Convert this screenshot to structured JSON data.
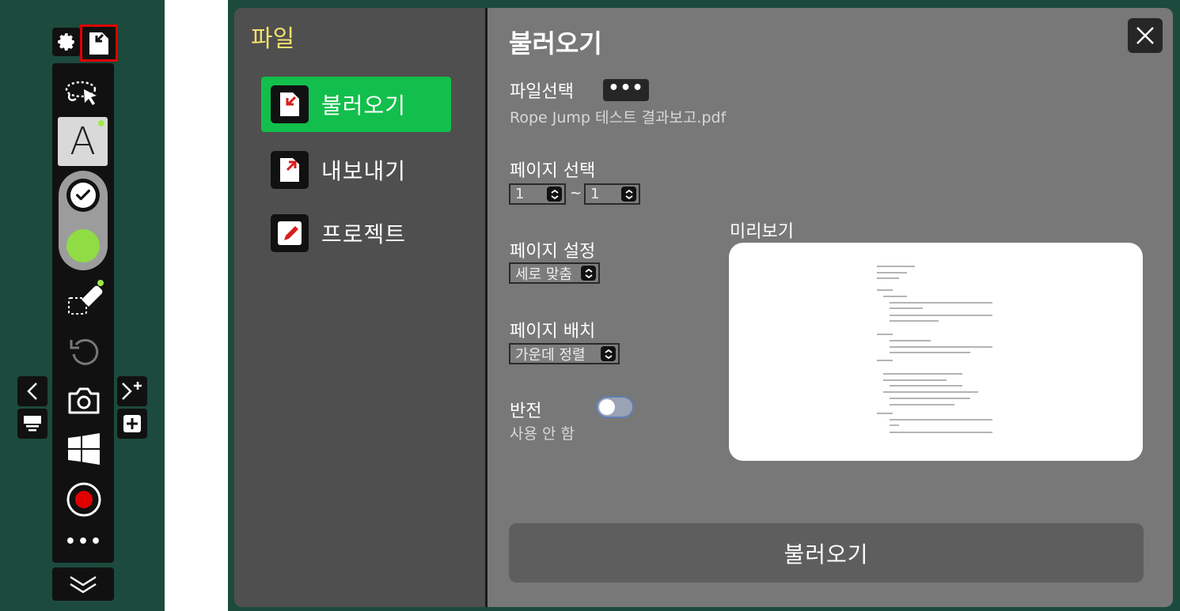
{
  "toolbar": {
    "icons": [
      "gear-icon",
      "file-load-icon",
      "lasso-select-icon",
      "pen-icon",
      "check-icon",
      "color-swatch-icon",
      "eraser-icon",
      "undo-icon",
      "camera-icon",
      "windows-icon",
      "record-icon",
      "more-icon",
      "chevron-double-down-icon",
      "chevron-left-icon",
      "board-icon",
      "add-page-icon",
      "plus-icon"
    ],
    "pen_label": "A",
    "more_label": "•••",
    "colors": {
      "background": "#1c4a3c",
      "active_color": "#8fdc44",
      "record": "#e00000",
      "highlight_border": "#e00000"
    }
  },
  "panel": {
    "nav_title": "파일",
    "nav_items": [
      {
        "label": "불러오기",
        "icon": "file-import-icon",
        "active": true
      },
      {
        "label": "내보내기",
        "icon": "file-export-icon",
        "active": false
      },
      {
        "label": "프로젝트",
        "icon": "pencil-edit-icon",
        "active": false
      }
    ],
    "title": "불러오기",
    "file_select_label": "파일선택",
    "browse_label": "•••",
    "file_name": "Rope Jump 테스트 결과보고.pdf",
    "page_select_label": "페이지 선택",
    "page_from": "1",
    "page_to": "1",
    "range_separator": "~",
    "page_setting_label": "페이지 설정",
    "page_setting_value": "세로 맞춤",
    "page_layout_label": "페이지 배치",
    "page_layout_value": "가운데 정렬",
    "invert_label": "반전",
    "invert_state": "사용 안 함",
    "invert_on": false,
    "preview_label": "미리보기",
    "submit_label": "불러오기",
    "colors": {
      "active_nav": "#12bf4c",
      "nav_title": "#f3e06a",
      "panel_bg": "#787878",
      "nav_bg": "#4f4f4f"
    }
  }
}
